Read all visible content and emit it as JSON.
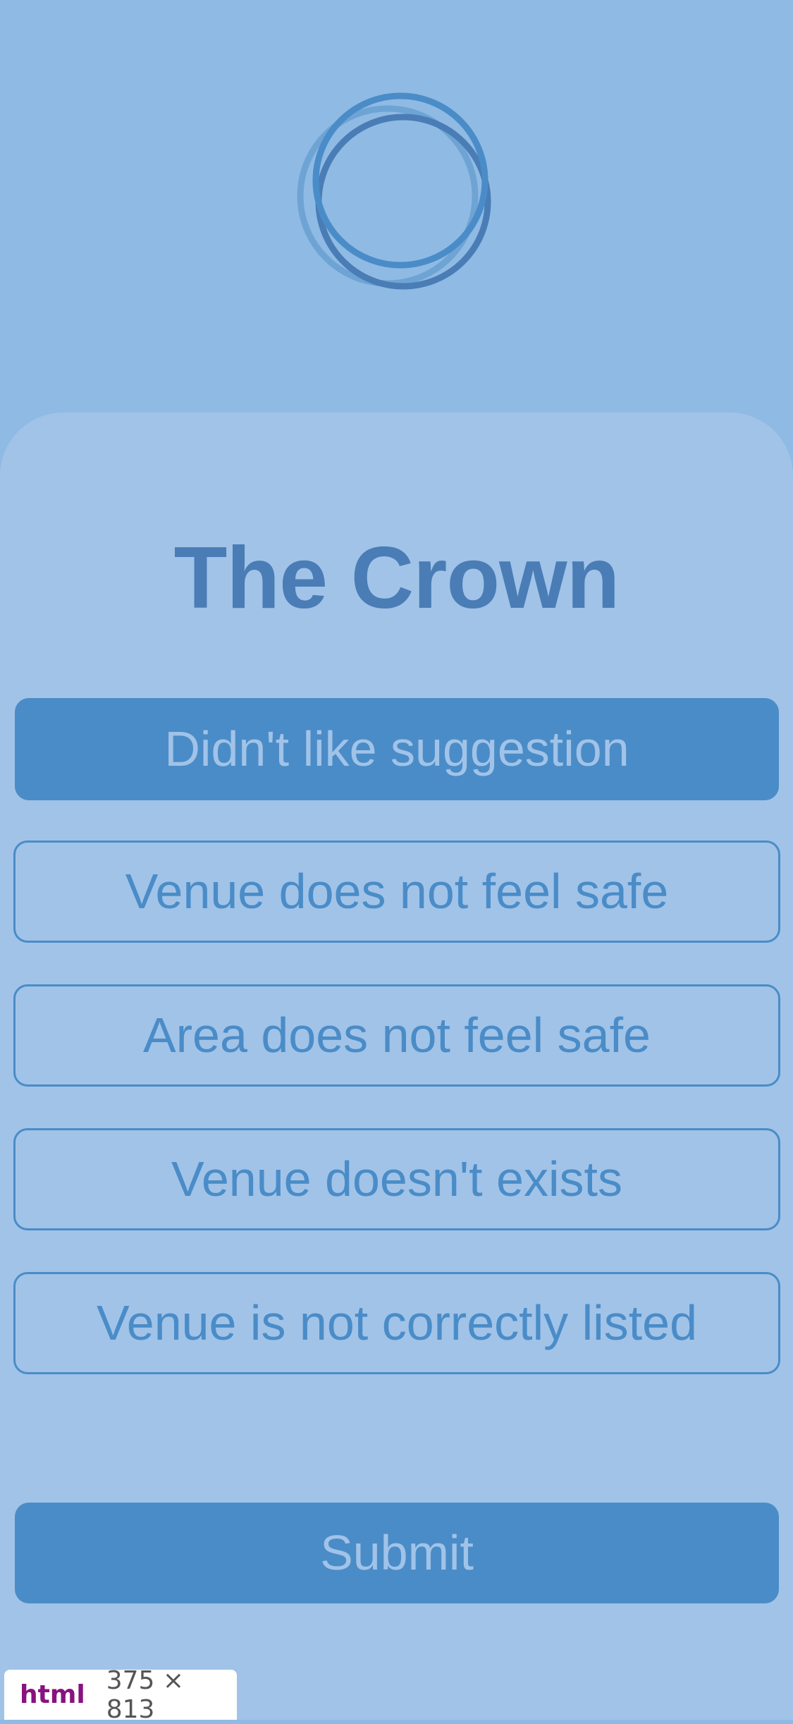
{
  "colors": {
    "background": "#8fbae4",
    "sheet": "#a1c3e8",
    "accent": "#4a8cc7",
    "title": "#4a7cb5"
  },
  "logo": {
    "icon": "interlocking-rings-icon"
  },
  "venue": {
    "name": "The Crown"
  },
  "reasons": [
    {
      "label": "Didn't like suggestion",
      "selected": true
    },
    {
      "label": "Venue does not feel safe",
      "selected": false
    },
    {
      "label": "Area does not feel safe",
      "selected": false
    },
    {
      "label": "Venue doesn't exists",
      "selected": false
    },
    {
      "label": "Venue is not correctly listed",
      "selected": false
    }
  ],
  "submit": {
    "label": "Submit"
  },
  "devtools_badge": {
    "tag": "html",
    "size": "375 × 813"
  }
}
